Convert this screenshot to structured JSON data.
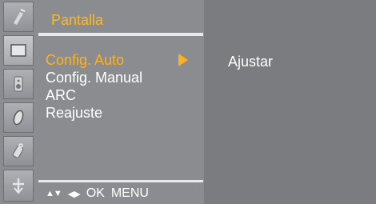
{
  "menu": {
    "title": "Pantalla",
    "items": [
      {
        "label": "Config. Auto",
        "active": true
      },
      {
        "label": "Config. Manual",
        "active": false
      },
      {
        "label": "ARC",
        "active": false
      },
      {
        "label": "Reajuste",
        "active": false
      }
    ]
  },
  "help": {
    "updown_glyph": "▲▼",
    "leftright_glyph": "◀▶",
    "ok_label": "OK",
    "menu_label": "MENU"
  },
  "submenu": {
    "value": "Ajustar"
  },
  "icons": [
    "satellite-icon",
    "screen-icon",
    "speaker-icon",
    "clock-icon",
    "key-lock-icon",
    "tools-icon"
  ],
  "colors": {
    "accent": "#ffb01f",
    "panel": "#8a8c90",
    "sub_panel": "#7a7c80",
    "text": "#ffffff"
  }
}
